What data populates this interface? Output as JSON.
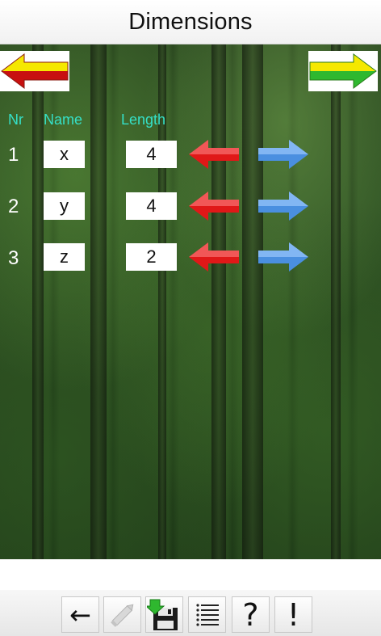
{
  "title": "Dimensions",
  "columns": {
    "nr": "Nr",
    "name": "Name",
    "length": "Length"
  },
  "rows": [
    {
      "nr": "1",
      "name": "x",
      "length": "4"
    },
    {
      "nr": "2",
      "name": "y",
      "length": "4"
    },
    {
      "nr": "3",
      "name": "z",
      "length": "2"
    }
  ],
  "nav": {
    "prev_icon": "arrow-left-icon",
    "next_icon": "arrow-right-icon"
  },
  "toolbar": {
    "back_glyph": "←",
    "help_glyph": "?",
    "info_glyph": "!"
  },
  "colors": {
    "header_text": "#35e0c8",
    "decrease_arrow": "#e01818",
    "increase_arrow": "#4a8fe0",
    "nav_arrow_yellow": "#f5e800",
    "nav_arrow_red": "#c81010",
    "nav_arrow_green": "#2fb82f"
  }
}
